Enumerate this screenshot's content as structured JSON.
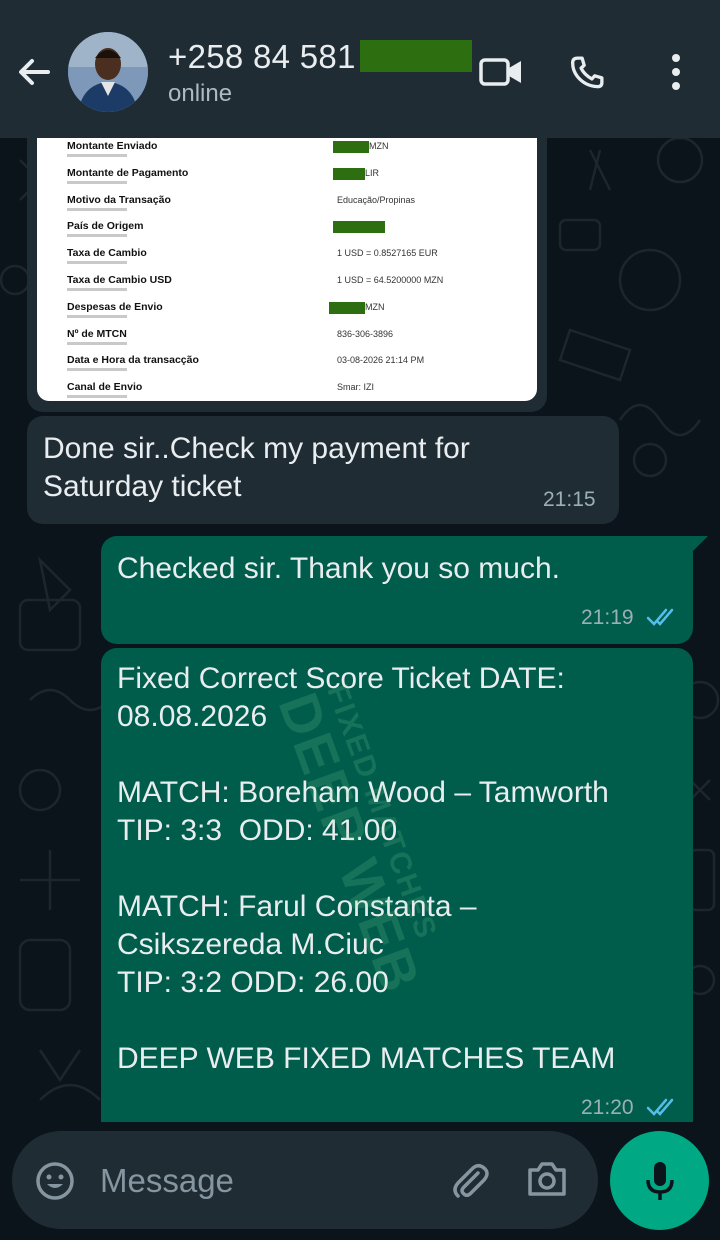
{
  "header": {
    "contact_name": "+258 84 581",
    "status": "online"
  },
  "receipt": {
    "rows": [
      {
        "label": "Montante Enviado",
        "value": "MZN"
      },
      {
        "label": "Montante de Pagamento",
        "value": "LIR"
      },
      {
        "label": "Motivo da Transação",
        "value": "Educação/Propinas"
      },
      {
        "label": "País de Origem",
        "value": ""
      },
      {
        "label": "Taxa de Cambio",
        "value": "1 USD = 0.8527165 EUR"
      },
      {
        "label": "Taxa de Cambio USD",
        "value": "1 USD = 64.5200000 MZN"
      },
      {
        "label": "Despesas de Envio",
        "value": "MZN"
      },
      {
        "label": "Nº de MTCN",
        "value": "836-306-3896"
      },
      {
        "label": "Data e Hora da transacção",
        "value": "03-08-2026 21:14 PM"
      },
      {
        "label": "Canal de Envio",
        "value": "Smar: IZI"
      }
    ]
  },
  "messages": [
    {
      "direction": "incoming",
      "text": "Done sir..Check my payment for\nSaturday ticket",
      "time": "21:15"
    },
    {
      "direction": "outgoing",
      "text": "Checked sir. Thank you so much.",
      "time": "21:19"
    },
    {
      "direction": "outgoing",
      "text": "Fixed Correct Score Ticket DATE:\n08.08.2026\n\nMATCH: Boreham Wood – Tamworth\nTIP: 3:3  ODD: 41.00\n\nMATCH: Farul Constanta –\nCsikszereda M.Ciuc\nTIP: 3:2 ODD: 26.00\n\nDEEP WEB FIXED MATCHES TEAM",
      "time": "21:20"
    }
  ],
  "watermark": {
    "line1": "DEEP WEB",
    "line2": "FIXED MATCHES"
  },
  "composer": {
    "placeholder": "Message"
  },
  "colors": {
    "background": "#0b141a",
    "header": "#1f2c34",
    "incoming_bubble": "#1f2c34",
    "outgoing_bubble": "#005c4b",
    "accent": "#00a884",
    "read_ticks": "#53bdeb",
    "redaction": "#2c6e10"
  },
  "icons": [
    "back-arrow-icon",
    "video-call-icon",
    "phone-icon",
    "more-vert-icon",
    "emoji-icon",
    "attach-icon",
    "camera-icon",
    "mic-icon"
  ]
}
